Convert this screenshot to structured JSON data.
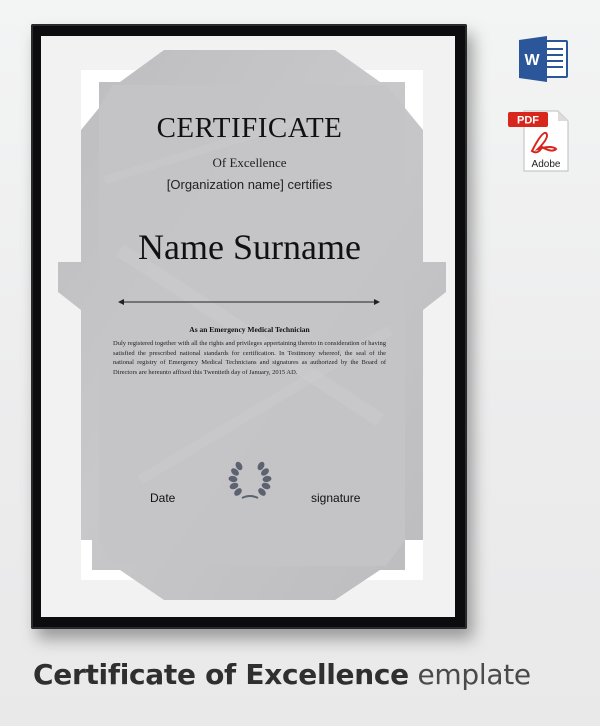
{
  "certificate": {
    "title": "CERTIFICATE",
    "subtitle": "Of Excellence",
    "organization_line": "[Organization name] certifies",
    "name": "Name Surname",
    "role": "As an Emergency Medical Technician",
    "body": "Duly registered together with all the rights and privileges appertaining thereto in consideration of having satisfied the prescribed national standards for certification. In Testimony whereof, the seal of the national registry of Emergency Medical Technicians and signatures as authorized by the Board of Directors are hereunto affixed this Twentieth day of January, 2015 AD.",
    "date_label": "Date",
    "signature_label": "signature"
  },
  "icons": {
    "word_letter": "W",
    "pdf_badge": "PDF",
    "pdf_brand": "Adobe"
  },
  "caption": {
    "bold_part": "Certificate of Excellence",
    "light_part": " emplate"
  },
  "colors": {
    "frame": "#0c0c0e",
    "certificate_gray": "#c2c2c4",
    "word_blue": "#2b579a",
    "pdf_red": "#d9261c"
  }
}
